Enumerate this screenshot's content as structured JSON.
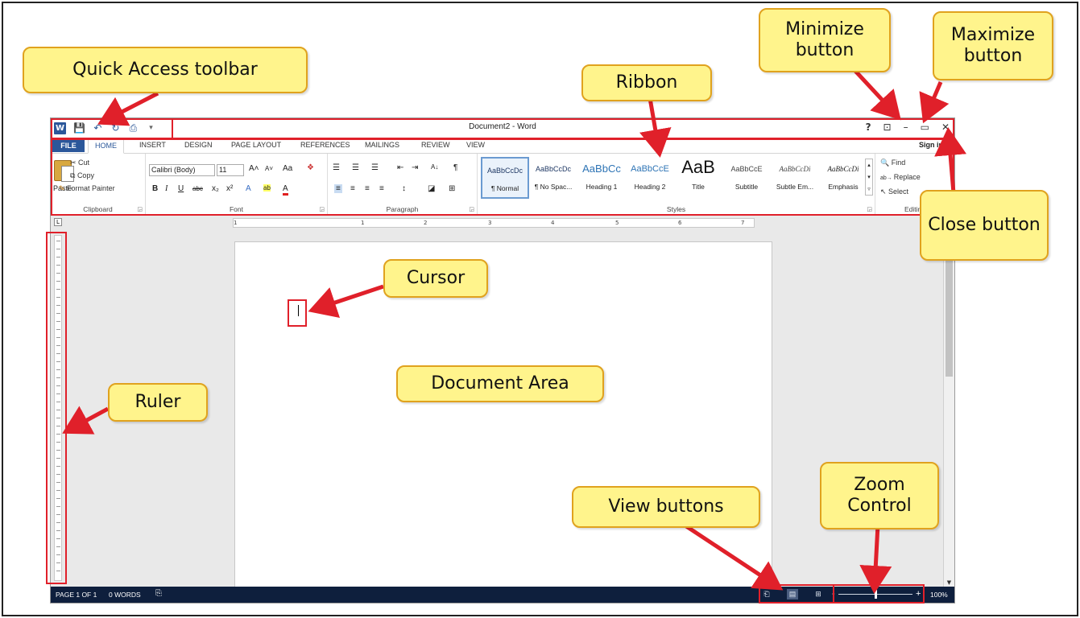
{
  "window": {
    "title": "Document2 - Word",
    "signin": "Sign in"
  },
  "qat": {
    "word_logo": "W",
    "save": "💾",
    "undo": "↶",
    "redo": "↻",
    "print": "⎙",
    "customize": "▾"
  },
  "window_controls": {
    "help": "?",
    "ribbon_display": "⊡",
    "minimize": "–",
    "maximize": "▭",
    "close": "✕"
  },
  "tabs": [
    "FILE",
    "HOME",
    "INSERT",
    "DESIGN",
    "PAGE LAYOUT",
    "REFERENCES",
    "MAILINGS",
    "REVIEW",
    "VIEW"
  ],
  "clipboard": {
    "paste": "Paste",
    "cut": "Cut",
    "copy": "Copy",
    "format_painter": "Format Painter",
    "label": "Clipboard"
  },
  "font": {
    "name": "Calibri (Body)",
    "size": "11",
    "grow": "A˄",
    "shrink": "A˅",
    "case": "Aa",
    "clear": "❖",
    "bold": "B",
    "italic": "I",
    "underline": "U",
    "strike": "abc",
    "subscript": "x₂",
    "superscript": "x²",
    "effects": "A",
    "highlight": "ab",
    "color": "A",
    "label": "Font"
  },
  "paragraph": {
    "bullets": "☰",
    "numbering": "☰",
    "multilevel": "☰",
    "dec_indent": "⇤",
    "inc_indent": "⇥",
    "sort": "A↓",
    "pilcrow": "¶",
    "align_left": "≡",
    "center": "≡",
    "align_right": "≡",
    "justify": "≡",
    "spacing": "↕",
    "shading": "◪",
    "borders": "⊞",
    "label": "Paragraph"
  },
  "styles": {
    "label": "Styles",
    "items": [
      {
        "sample": "AaBbCcDc",
        "name": "¶ Normal"
      },
      {
        "sample": "AaBbCcDc",
        "name": "¶ No Spac..."
      },
      {
        "sample": "AaBbCc",
        "name": "Heading 1"
      },
      {
        "sample": "AaBbCcE",
        "name": "Heading 2"
      },
      {
        "sample": "AaB",
        "name": "Title"
      },
      {
        "sample": "AaBbCcE",
        "name": "Subtitle"
      },
      {
        "sample": "AaBbCcDi",
        "name": "Subtle Em..."
      },
      {
        "sample": "AaBbCcDi",
        "name": "Emphasis"
      }
    ]
  },
  "editing": {
    "find": "Find",
    "replace": "Replace",
    "select": "Select",
    "label": "Editing"
  },
  "hruler_numbers": [
    "1",
    "1",
    "2",
    "3",
    "4",
    "5",
    "6",
    "7"
  ],
  "status": {
    "page": "PAGE 1 OF 1",
    "words": "0 WORDS",
    "proof": "⎘",
    "zoom": "100%",
    "zoom_minus": "-",
    "zoom_plus": "+",
    "zoom_level": 0.5
  },
  "view_buttons": {
    "read": "⎗",
    "print_layout": "▤",
    "web": "⊞"
  },
  "callouts": {
    "quick_access": "Quick Access toolbar",
    "ribbon": "Ribbon",
    "minimize": "Minimize button",
    "maximize": "Maximize button",
    "close": "Close button",
    "cursor": "Cursor",
    "document_area": "Document Area",
    "ruler": "Ruler",
    "view_buttons": "View buttons",
    "zoom": "Zoom Control"
  },
  "colors": {
    "callout_fill": "#fff48c",
    "callout_border": "#e0a21e",
    "arrow": "#e0202a",
    "word_blue": "#2b579a",
    "status_bar": "#0e1f3d"
  }
}
